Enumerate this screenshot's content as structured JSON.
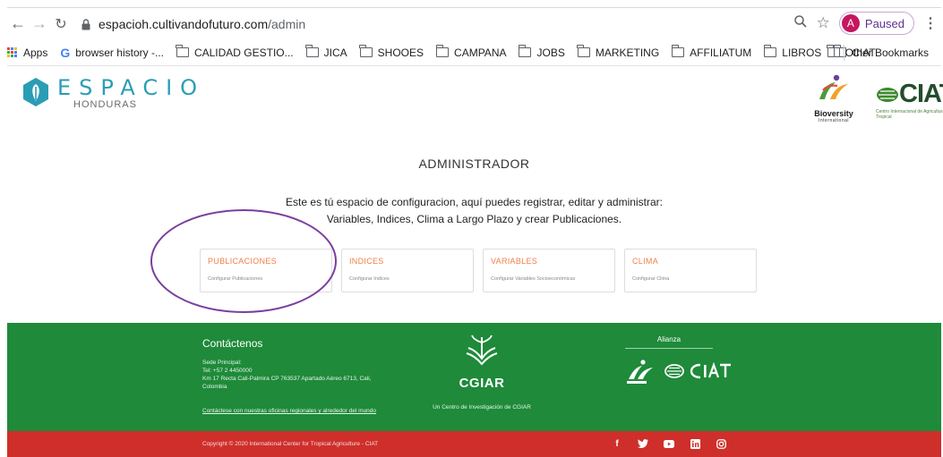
{
  "browser": {
    "url_domain": "espacioh.cultivandofuturo.com",
    "url_path": "/admin",
    "profile_initial": "A",
    "profile_status": "Paused"
  },
  "bookmarks": {
    "apps_label": "Apps",
    "items": [
      "browser history -...",
      "CALIDAD GESTIO...",
      "JICA",
      "SHOOES",
      "CAMPANA",
      "JOBS",
      "MARKETING",
      "AFFILIATUM",
      "LIBROS",
      "CIAT"
    ],
    "other": "Other Bookmarks"
  },
  "header": {
    "logo_title": "ESPACIO",
    "logo_sub": "HONDURAS",
    "partner_bioversity": "Bioversity",
    "partner_bioversity_sub": "International",
    "partner_ciat": "CIAT",
    "partner_ciat_sub": "Centro Internacional de Agricultura Tropical"
  },
  "main": {
    "title": "ADMINISTRADOR",
    "desc_line1": "Este es tú espacio de configuracion, aquí puedes registrar, editar y administrar:",
    "desc_line2": "Variables, Indices, Clima a Largo Plazo y crear Publicaciones.",
    "cards": [
      {
        "title": "PUBLICACIONES",
        "sub": "Configurar Publicaciones"
      },
      {
        "title": "INDICES",
        "sub": "Configurar Indices"
      },
      {
        "title": "VARIABLES",
        "sub": "Configurar Variables Socioeconómicas"
      },
      {
        "title": "CLIMA",
        "sub": "Configurar Clima"
      }
    ]
  },
  "footer": {
    "contact_title": "Contáctenos",
    "contact_hq": "Sede Principal:",
    "contact_tel": "Tel: +57 2 4450000",
    "contact_address": "Km 17 Recta Cali-Palmira CP 763537 Apartado Aéreo 6713, Cali,",
    "contact_country": "Colombia",
    "contact_link": "Contáctese con nuestras oficinas regionales y alrededor del mundo",
    "cgiar_word": "CGIAR",
    "cgiar_sub": "Un Centro de Investigación de CGIAR",
    "alianza": "Alianza",
    "copyright": "Copyright © 2020 International Center for Tropical Agriculture - CIAT"
  },
  "colors": {
    "green_footer": "#1e8a3a",
    "red_footer": "#cf2f2a",
    "card_title": "#f0804a",
    "logo_teal": "#2a9db5",
    "annotation_circle": "#7b3fa0"
  }
}
